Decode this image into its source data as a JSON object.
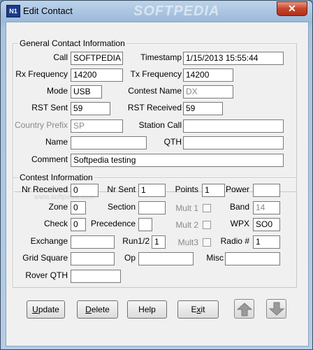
{
  "window": {
    "title": "Edit Contact",
    "app_icon_text": "N1",
    "watermark": "SOFTPEDIA",
    "close_glyph": "✕"
  },
  "general": {
    "title": "General Contact Information",
    "call_label": "Call",
    "call_value": "SOFTPEDIA",
    "timestamp_label": "Timestamp",
    "timestamp_value": "1/15/2013 15:55:44",
    "rx_label": "Rx Frequency",
    "rx_value": "14200",
    "tx_label": "Tx Frequency",
    "tx_value": "14200",
    "mode_label": "Mode",
    "mode_value": "USB",
    "contest_name_label": "Contest Name",
    "contest_name_value": "DX",
    "rst_sent_label": "RST Sent",
    "rst_sent_value": "59",
    "rst_received_label": "RST Received",
    "rst_received_value": "59",
    "country_prefix_label": "Country Prefix",
    "country_prefix_value": "SP",
    "station_call_label": "Station Call",
    "station_call_value": "",
    "name_label": "Name",
    "name_value": "",
    "qth_label": "QTH",
    "qth_value": "",
    "comment_label": "Comment",
    "comment_value": "Softpedia testing"
  },
  "contest": {
    "title": "Contest Information",
    "nr_received_label": "Nr Received",
    "nr_received_value": "0",
    "nr_sent_label": "Nr Sent",
    "nr_sent_value": "1",
    "points_label": "Points",
    "points_value": "1",
    "power_label": "Power",
    "power_value": "",
    "zone_label": "Zone",
    "zone_value": "0",
    "section_label": "Section",
    "section_value": "",
    "mult1_label": "Mult 1",
    "band_label": "Band",
    "band_value": "14",
    "check_label": "Check",
    "check_value": "0",
    "precedence_label": "Precedence",
    "precedence_value": "",
    "mult2_label": "Mult 2",
    "wpx_label": "WPX",
    "wpx_value": "SO0",
    "exchange_label": "Exchange",
    "exchange_value": "",
    "run12_label": "Run1/2",
    "run12_value": "1",
    "mult3_label": "Mult3",
    "radio_label": "Radio #",
    "radio_value": "1",
    "grid_label": "Grid Square",
    "grid_value": "",
    "op_label": "Op",
    "op_value": "",
    "misc_label": "Misc",
    "misc_value": "",
    "rover_label": "Rover QTH",
    "rover_value": ""
  },
  "buttons": {
    "update_u": "U",
    "update_rest": "pdate",
    "delete_u": "D",
    "delete_rest": "elete",
    "help": "Help",
    "exit_pre": "E",
    "exit_u": "x",
    "exit_rest": "it"
  }
}
